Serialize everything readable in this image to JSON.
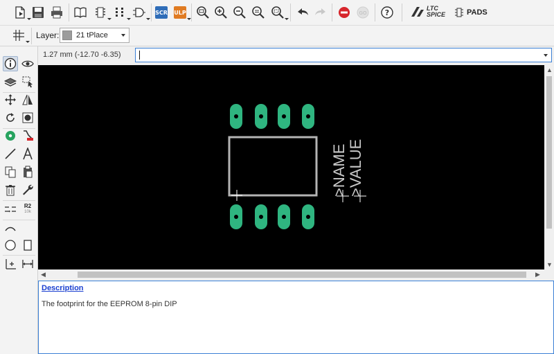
{
  "toolbar": {
    "scr_label": "SCR",
    "ulp_label": "ULP",
    "ltspice_line1": "LTC",
    "ltspice_line2": "SPICE",
    "pads_label": "PADS"
  },
  "layer": {
    "label": "Layer:",
    "selected": "21 tPlace",
    "swatch_color": "#9c9c9c"
  },
  "status": {
    "coordinates": "1.27 mm (-12.70 -6.35)"
  },
  "command_line": {
    "value": ""
  },
  "canvas": {
    "background": "#000000",
    "pad_color": "#2fb580",
    "outline_color": "#b4b4b4",
    "name_text": ">NAME",
    "value_text": ">VALUE"
  },
  "left_tools": {
    "r2_label": "R2",
    "r2_sub": "10k"
  },
  "description": {
    "title": "Description",
    "text": "The footprint for the EEPROM 8-pin DIP"
  }
}
